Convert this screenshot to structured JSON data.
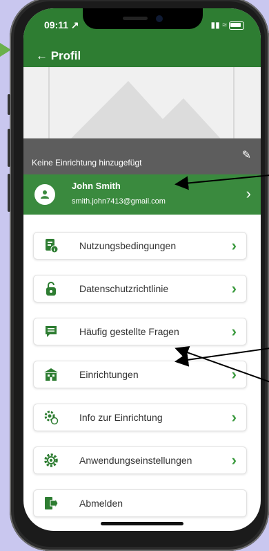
{
  "status": {
    "time": "09:11 ↗"
  },
  "header": {
    "back_label": "← Profil"
  },
  "cover": {
    "no_facility_text": "Keine Einrichtung hinzugefügt"
  },
  "profile": {
    "name": "John Smith",
    "email": "smith.john7413@gmail.com"
  },
  "menu": {
    "items": [
      {
        "label": "Nutzungsbedingungen",
        "icon": "document-info-icon"
      },
      {
        "label": "Datenschutzrichtlinie",
        "icon": "lock-icon"
      },
      {
        "label": "Häufig gestellte Fragen",
        "icon": "chat-icon"
      },
      {
        "label": "Einrichtungen",
        "icon": "building-icon"
      },
      {
        "label": "Info zur Einrichtung",
        "icon": "gear-info-icon"
      },
      {
        "label": "Anwendungseinstellungen",
        "icon": "settings-gear-icon"
      },
      {
        "label": "Abmelden",
        "icon": "logout-icon"
      }
    ]
  },
  "colors": {
    "header_green": "#2e7d32",
    "profile_green": "#3a8a3e",
    "accent": "#3a9a3e",
    "background": "#c9c7ef"
  }
}
